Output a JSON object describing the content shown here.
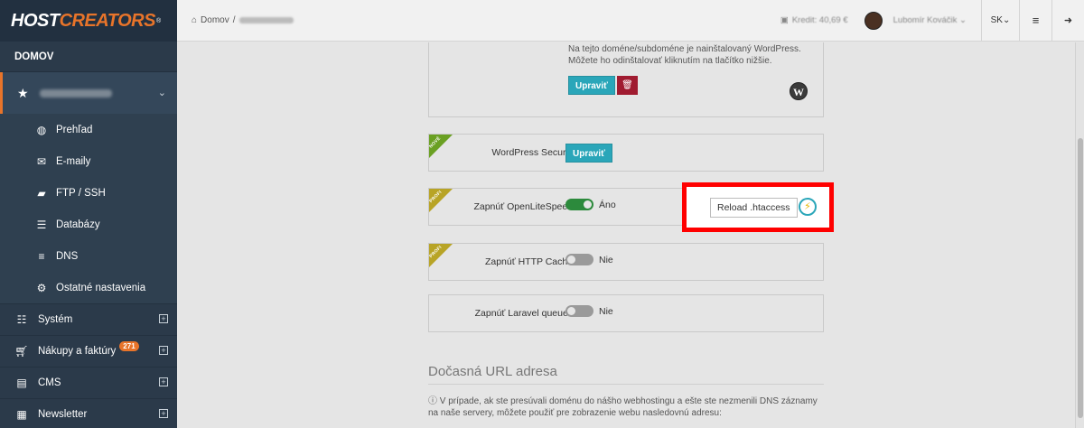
{
  "sidebar": {
    "logo_part1": "HOST",
    "logo_part2": "CREATORS",
    "logo_reg": "®",
    "domov": "DOMOV",
    "domain_icon": "star-icon",
    "sub_items": [
      {
        "label": "Prehľad",
        "icon": "globe-icon"
      },
      {
        "label": "E-maily",
        "icon": "envelope-icon"
      },
      {
        "label": "FTP / SSH",
        "icon": "folder-open-icon"
      },
      {
        "label": "Databázy",
        "icon": "database-icon"
      },
      {
        "label": "DNS",
        "icon": "server-icon"
      },
      {
        "label": "Ostatné nastavenia",
        "icon": "gear-icon"
      }
    ],
    "main_items": [
      {
        "label": "Systém",
        "icon": "sliders-icon"
      },
      {
        "label": "Nákupy a faktúry",
        "icon": "cart-icon",
        "badge": "271"
      },
      {
        "label": "CMS",
        "icon": "file-icon"
      },
      {
        "label": "Newsletter",
        "icon": "newspaper-icon"
      }
    ]
  },
  "topbar": {
    "crumb_home": "Domov",
    "crumb_sep": "/",
    "credit": "Kredit: 40,69 €",
    "user": "Lubomír Kováčik",
    "lang": "SK"
  },
  "wp_box": {
    "text": "Na tejto doméne/subdoméne je nainštalovaný WordPress. Môžete ho odinštalovať kliknutím na tlačítko nižšie.",
    "edit_label": "Upraviť"
  },
  "rows": [
    {
      "ribbon": "NOVÉ",
      "label": "WordPress Security",
      "button": "Upraviť"
    },
    {
      "ribbon": "PROFI",
      "label": "Zapnúť OpenLiteSpeed:",
      "toggle": "on",
      "value": "Áno"
    },
    {
      "ribbon": "PROFI",
      "label": "Zapnúť HTTP Cache:",
      "toggle": "off",
      "value": "Nie"
    },
    {
      "label": "Zapnúť Laravel queues:",
      "toggle": "off",
      "value": "Nie"
    }
  ],
  "reload": {
    "label": "Reload .htaccess"
  },
  "temp_url": {
    "title": "Dočasná URL adresa",
    "info": "V prípade, ak ste presúvali doménu do nášho webhostingu a ešte ste nezmenili DNS záznamy na naše servery, môžete použiť pre zobrazenie webu nasledovnú adresu:"
  },
  "colors": {
    "accent": "#e8742a",
    "teal": "#2aa6b9",
    "highlight": "#ff0000",
    "sidebar": "#2b3a4a"
  }
}
